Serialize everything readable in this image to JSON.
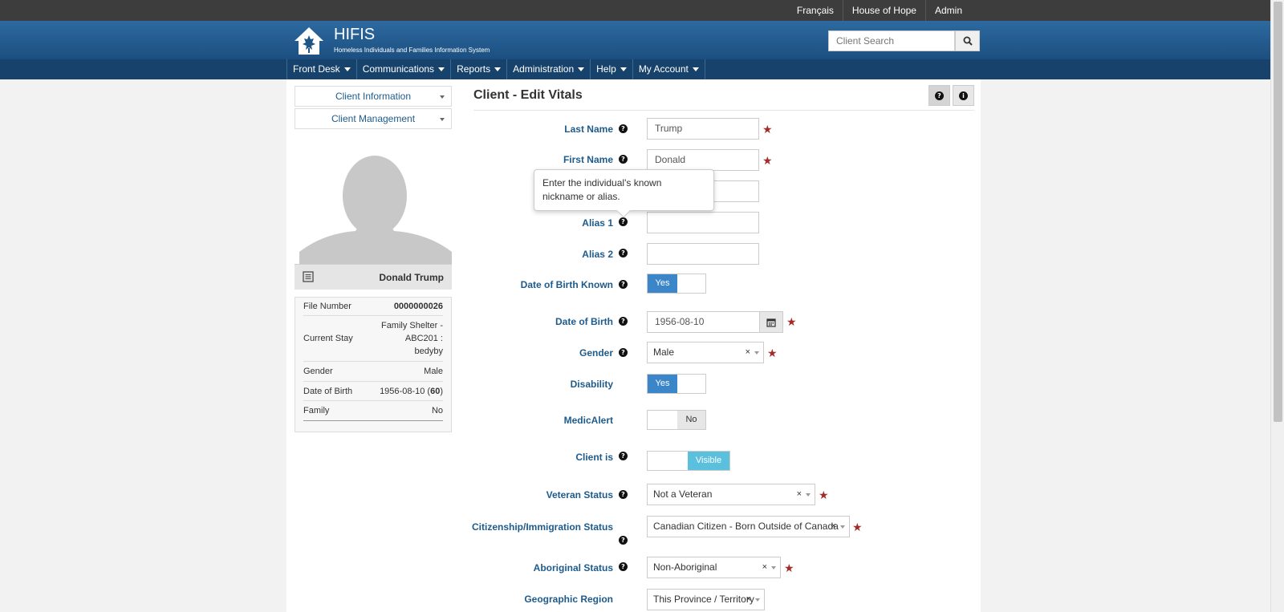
{
  "topbar": {
    "links": [
      "Français",
      "House of Hope",
      "Admin"
    ]
  },
  "header": {
    "title": "HIFIS",
    "subtitle": "Homeless Individuals and Families Information System",
    "search_placeholder": "Client Search"
  },
  "nav": {
    "items": [
      "Front Desk",
      "Communications",
      "Reports",
      "Administration",
      "Help",
      "My Account"
    ]
  },
  "sidebar": {
    "client_information": "Client Information",
    "client_management": "Client Management",
    "client_name": "Donald Trump",
    "info": [
      {
        "label": "File Number",
        "value": "0000000026"
      },
      {
        "label": "Current Stay",
        "value": "Family Shelter - ABC201 : bedyby"
      },
      {
        "label": "Gender",
        "value": "Male"
      },
      {
        "label": "Date of Birth",
        "value": "1956-08-10",
        "age": "60"
      },
      {
        "label": "Family",
        "value": "No"
      }
    ]
  },
  "page": {
    "title": "Client - Edit Vitals"
  },
  "form": {
    "last_name": {
      "label": "Last Name",
      "value": "Trump"
    },
    "first_name": {
      "label": "First Name",
      "value": "Donald"
    },
    "middle_name": {
      "value": ""
    },
    "alias1": {
      "label": "Alias 1",
      "value": ""
    },
    "alias2": {
      "label": "Alias 2",
      "value": ""
    },
    "dob_known": {
      "label": "Date of Birth Known",
      "value": "Yes"
    },
    "dob": {
      "label": "Date of Birth",
      "value": "1956-08-10"
    },
    "gender": {
      "label": "Gender",
      "value": "Male"
    },
    "disability": {
      "label": "Disability",
      "value": "Yes"
    },
    "medicalert": {
      "label": "MedicAlert",
      "value": "No"
    },
    "client_is": {
      "label": "Client is",
      "value": "Visible"
    },
    "veteran_status": {
      "label": "Veteran Status",
      "value": "Not a Veteran"
    },
    "citizenship": {
      "label": "Citizenship/Immigration Status",
      "value": "Canadian Citizen - Born Outside of Canada"
    },
    "aboriginal": {
      "label": "Aboriginal Status",
      "value": "Non-Aboriginal"
    },
    "geo_region": {
      "label": "Geographic Region",
      "value": "This Province / Territory"
    }
  },
  "tooltip": {
    "text": "Enter the individual's known nickname or alias."
  },
  "colors": {
    "header": "#1c4f80",
    "nav": "#16426b",
    "label": "#1d5b8c",
    "toggle_on": "#3a86c9",
    "visible": "#5bc0de",
    "required_star": "#a52a2a"
  },
  "icons": {
    "required": "★",
    "remove": "×",
    "help": "?",
    "info": "i"
  }
}
